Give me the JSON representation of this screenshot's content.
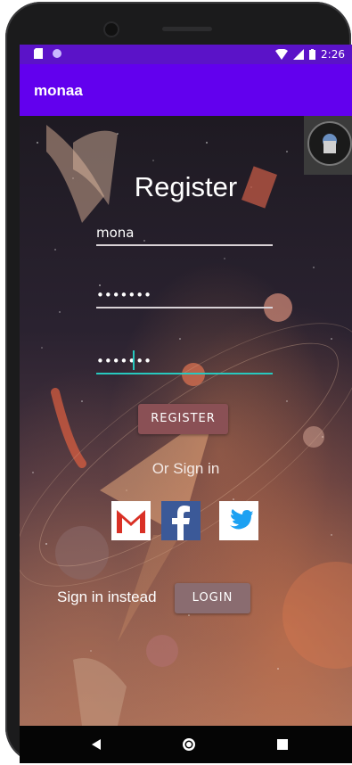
{
  "status_bar": {
    "time": "2:26"
  },
  "app_bar": {
    "title": "monaa"
  },
  "form": {
    "title": "Register",
    "username_value": "mona",
    "password_mask": "•••••••",
    "confirm_mask": "•••••••",
    "register_label": "REGISTER",
    "or_text": "Or Sign in",
    "sign_in_text": "Sign in instead",
    "login_label": "LOGIN"
  },
  "social": {
    "gmail_letter": "M",
    "facebook_letter": "f"
  },
  "colors": {
    "status_bar": "#5b13c8",
    "app_bar": "#6200ee",
    "register_button": "#8a5055",
    "login_button": "#8a6c70",
    "field_focus": "#27c9bf",
    "facebook": "#3b5998",
    "twitter": "#1da1f2",
    "gmail_red": "#d93025"
  },
  "icons": [
    "sd-card-icon",
    "record-icon",
    "wifi-icon",
    "signal-icon",
    "battery-icon",
    "gmail-icon",
    "facebook-icon",
    "twitter-icon",
    "back-icon",
    "home-icon",
    "recents-icon"
  ]
}
